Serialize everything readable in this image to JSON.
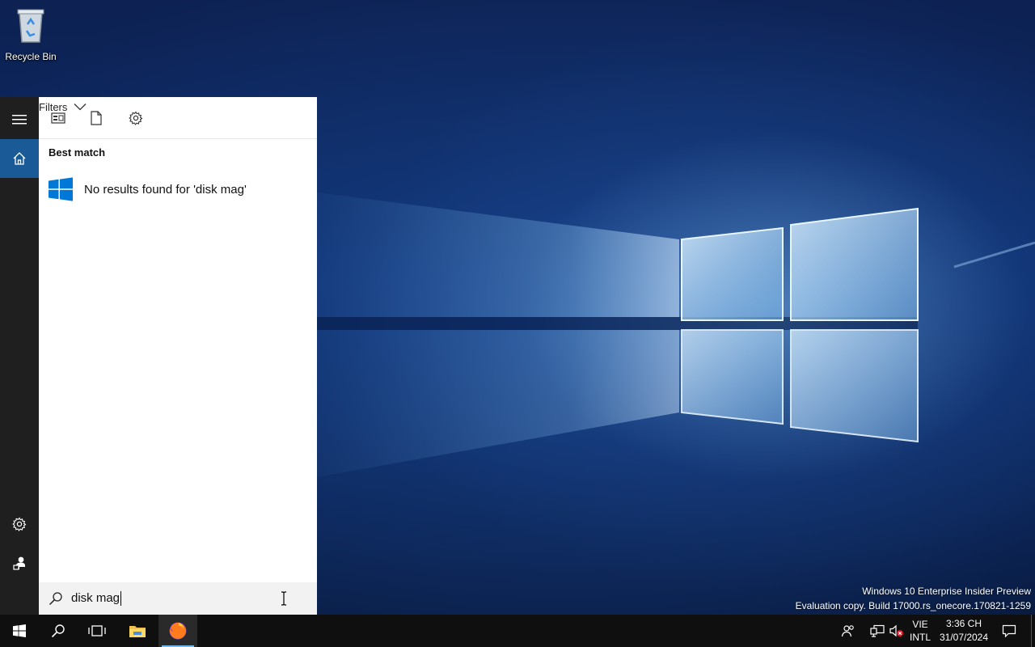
{
  "desktop": {
    "recycle_bin_label": "Recycle Bin",
    "watermark_line1": "Windows 10 Enterprise Insider Preview",
    "watermark_line2": "Evaluation copy. Build 17000.rs_onecore.170821-1259"
  },
  "search_panel": {
    "toolbar": {
      "filters_label": "Filters"
    },
    "best_match_heading": "Best match",
    "result_text": "No results found for 'disk mag'",
    "search_query": "disk mag",
    "rail_icons": [
      "hamburger-menu-icon",
      "home-icon",
      "gear-icon",
      "user-icon"
    ],
    "toolbar_icons": [
      "apps-icon",
      "document-icon",
      "gear-icon",
      "chevron-down-icon"
    ]
  },
  "taskbar": {
    "items": [
      "windows-logo-icon",
      "search-icon",
      "task-view-icon",
      "file-explorer-icon",
      "firefox-icon"
    ],
    "tray": {
      "lang_line1": "VIE",
      "lang_line2": "INTL",
      "time": "3:36 CH",
      "date": "31/07/2024"
    }
  },
  "colors": {
    "accent": "#1a5a96",
    "rail_bg": "#1f1f1f",
    "taskbar_bg": "#0f0f10",
    "windows_blue": "#0078d7"
  }
}
